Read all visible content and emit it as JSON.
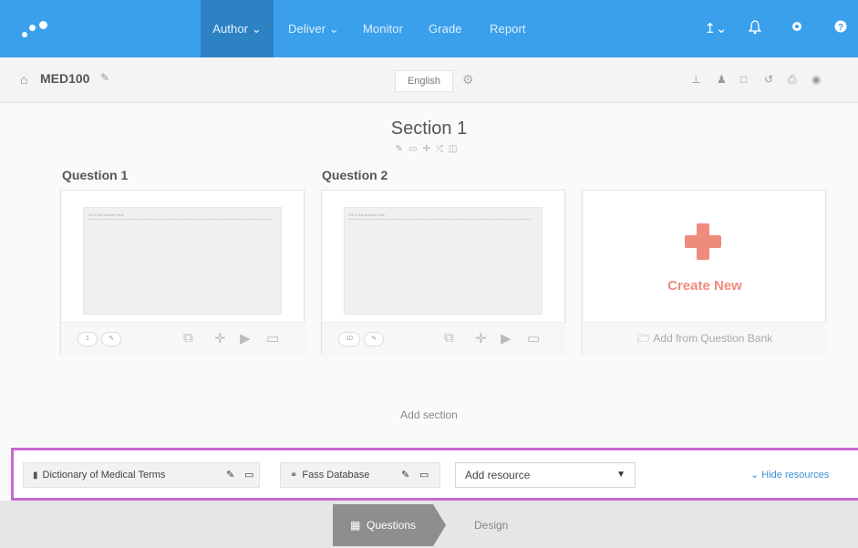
{
  "nav": {
    "items": [
      {
        "label": "Author ⌄",
        "active": true
      },
      {
        "label": "Deliver ⌄"
      },
      {
        "label": "Monitor"
      },
      {
        "label": "Grade"
      },
      {
        "label": "Report"
      }
    ],
    "icons": [
      "upload-icon",
      "bell-icon",
      "gear-icon",
      "help-icon"
    ],
    "accent": "#3aa0ec"
  },
  "course": {
    "title": "MED100",
    "language": "English",
    "tools": [
      "sitemap-icon",
      "person-icon",
      "copy-icon",
      "history-icon",
      "print-icon",
      "preview-icon"
    ]
  },
  "section": {
    "title": "Section 1"
  },
  "questions": [
    {
      "label": "Question 1",
      "points": "1",
      "preview_text": "Fill in the answer here"
    },
    {
      "label": "Question 2",
      "points": "10",
      "preview_text": "Fill in the answer here"
    }
  ],
  "create": {
    "label": "Create New",
    "bank": "Add from Question Bank",
    "color": "#ef8b7d"
  },
  "add_section": "Add section",
  "resources": {
    "items": [
      {
        "label": "Dictionary of Medical Terms"
      },
      {
        "label": "Fass Database"
      }
    ],
    "add_placeholder": "Add resource",
    "hide_label": "Hide resources",
    "highlight_color": "#c76ad3"
  },
  "steps": {
    "questions": "Questions",
    "design": "Design"
  }
}
